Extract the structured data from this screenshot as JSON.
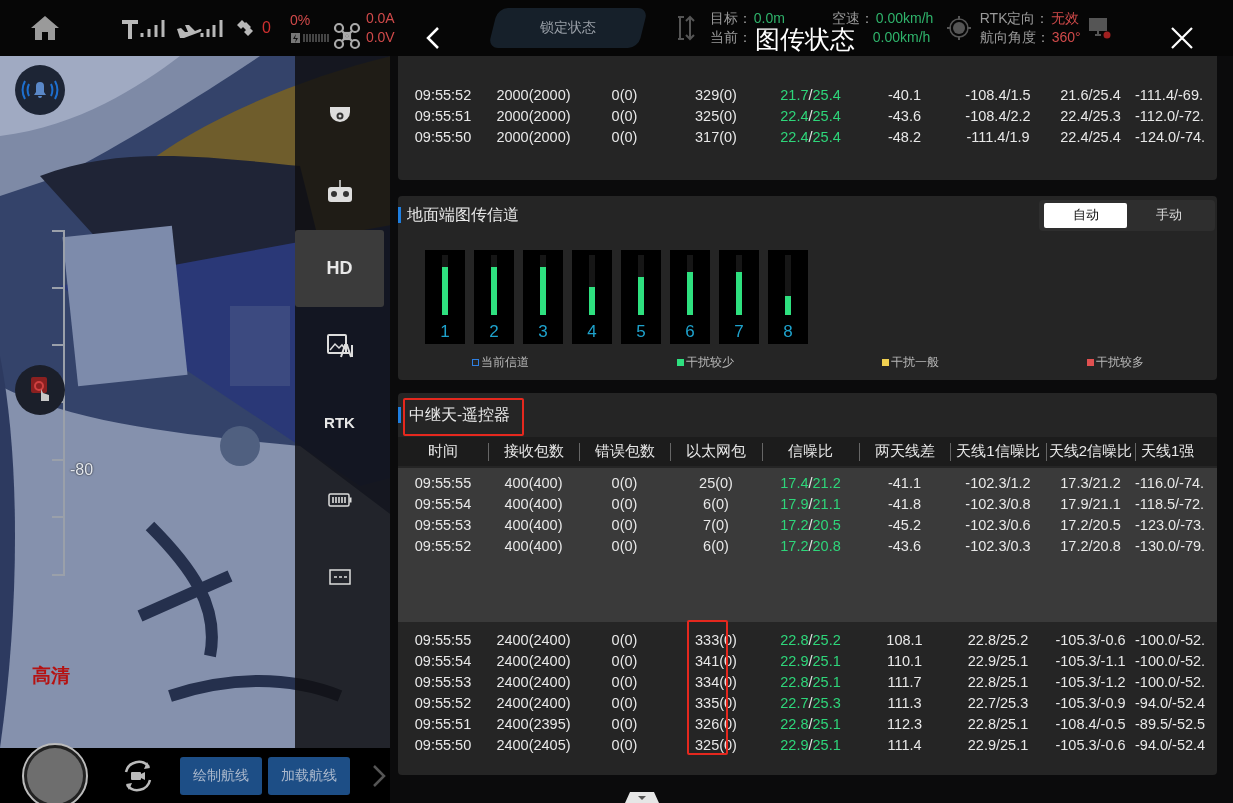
{
  "top_bar": {
    "satellite_count": "0",
    "battery_percent": "0%",
    "current": "0.0A",
    "voltage": "0.0V",
    "lock_status": "锁定状态",
    "target_label": "目标：",
    "target_value": "0.0m",
    "current_label": "当前：",
    "airspeed_label": "空速：",
    "airspeed_value": "0.00km/h",
    "speed_value": "0.00km/h",
    "rtk_label": "RTK定向：",
    "rtk_value": "无效",
    "heading_label": "航向角度：",
    "heading_value": "360°"
  },
  "camera_view": {
    "kind": "picture",
    "scale_label": "-80",
    "quality": "高清"
  },
  "bottom_bar": {
    "buttons": [
      "绘制航线",
      "加载航线"
    ]
  },
  "sidebar": {
    "items": [
      {
        "kind": "gimbal",
        "selected": false
      },
      {
        "kind": "remote",
        "selected": false
      },
      {
        "kind": "text",
        "label": "HD",
        "selected": true
      },
      {
        "kind": "ai",
        "selected": false
      },
      {
        "kind": "text",
        "label": "RTK",
        "selected": false
      },
      {
        "kind": "battery",
        "selected": false
      },
      {
        "kind": "more",
        "selected": false
      }
    ]
  },
  "dialog": {
    "title": "图传状态"
  },
  "air_link_table": {
    "rows": [
      [
        "09:55:52",
        "2000(2000)",
        "0(0)",
        "329(0)",
        "21.7/25.4",
        "-40.1",
        "-108.4/1.5",
        "21.6/25.4",
        "-111.4/-69."
      ],
      [
        "09:55:51",
        "2000(2000)",
        "0(0)",
        "325(0)",
        "22.4/25.4",
        "-43.6",
        "-108.4/2.2",
        "22.4/25.3",
        "-112.0/-72."
      ],
      [
        "09:55:50",
        "2000(2000)",
        "0(0)",
        "317(0)",
        "22.4/25.4",
        "-48.2",
        "-111.4/1.9",
        "22.4/25.4",
        "-124.0/-74."
      ]
    ]
  },
  "ground_channel": {
    "title": "地面端图传信道",
    "modes": [
      {
        "label": "自动",
        "selected": true
      },
      {
        "label": "手动",
        "selected": false
      }
    ],
    "channels": [
      {
        "label": "1",
        "level": 0.8
      },
      {
        "label": "2",
        "level": 0.8
      },
      {
        "label": "3",
        "level": 0.8
      },
      {
        "label": "4",
        "level": 0.47
      },
      {
        "label": "5",
        "level": 0.63
      },
      {
        "label": "6",
        "level": 0.72
      },
      {
        "label": "7",
        "level": 0.72
      },
      {
        "label": "8",
        "level": 0.32
      }
    ],
    "legend": [
      {
        "label": "当前信道",
        "kind": "outline",
        "color": "#2f7fe0"
      },
      {
        "label": "干扰较少",
        "kind": "filled",
        "color": "#2ee07f"
      },
      {
        "label": "干扰一般",
        "kind": "filled",
        "color": "#f0d050"
      },
      {
        "label": "干扰较多",
        "kind": "filled",
        "color": "#e05050"
      }
    ]
  },
  "relay_table": {
    "title": "中继天-遥控器",
    "title_annotated": true,
    "columns": [
      "时间",
      "接收包数",
      "错误包数",
      "以太网包",
      "信噪比",
      "两天线差",
      "天线1信噪比",
      "天线2信噪比",
      "天线1强"
    ],
    "groups": [
      {
        "annotated": false,
        "rows": [
          [
            "09:55:55",
            "400(400)",
            "0(0)",
            "25(0)",
            "17.4/21.2",
            "-41.1",
            "-102.3/1.2",
            "17.3/21.2",
            "-116.0/-74."
          ],
          [
            "09:55:54",
            "400(400)",
            "0(0)",
            "6(0)",
            "17.9/21.1",
            "-41.8",
            "-102.3/0.8",
            "17.9/21.1",
            "-118.5/-72."
          ],
          [
            "09:55:53",
            "400(400)",
            "0(0)",
            "7(0)",
            "17.2/20.5",
            "-45.2",
            "-102.3/0.6",
            "17.2/20.5",
            "-123.0/-73."
          ],
          [
            "09:55:52",
            "400(400)",
            "0(0)",
            "6(0)",
            "17.2/20.8",
            "-43.6",
            "-102.3/0.3",
            "17.2/20.8",
            "-130.0/-79."
          ]
        ]
      },
      {
        "annotated": true,
        "rows": [
          [
            "09:55:55",
            "2400(2400)",
            "0(0)",
            "333(0)",
            "22.8/25.2",
            "108.1",
            "22.8/25.2",
            "-105.3/-0.6",
            "-100.0/-52."
          ],
          [
            "09:55:54",
            "2400(2400)",
            "0(0)",
            "341(0)",
            "22.9/25.1",
            "110.1",
            "22.9/25.1",
            "-105.3/-1.1",
            "-100.0/-52."
          ],
          [
            "09:55:53",
            "2400(2400)",
            "0(0)",
            "334(0)",
            "22.8/25.1",
            "111.7",
            "22.8/25.1",
            "-105.3/-1.2",
            "-100.0/-52."
          ],
          [
            "09:55:52",
            "2400(2400)",
            "0(0)",
            "335(0)",
            "22.7/25.3",
            "111.3",
            "22.7/25.3",
            "-105.3/-0.9",
            "-94.0/-52.4"
          ],
          [
            "09:55:51",
            "2400(2395)",
            "0(0)",
            "326(0)",
            "22.8/25.1",
            "112.3",
            "22.8/25.1",
            "-108.4/-0.5",
            "-89.5/-52.5"
          ],
          [
            "09:55:50",
            "2400(2405)",
            "0(0)",
            "325(0)",
            "22.9/25.1",
            "111.4",
            "22.9/25.1",
            "-105.3/-0.6",
            "-94.0/-52.4"
          ]
        ]
      }
    ]
  }
}
